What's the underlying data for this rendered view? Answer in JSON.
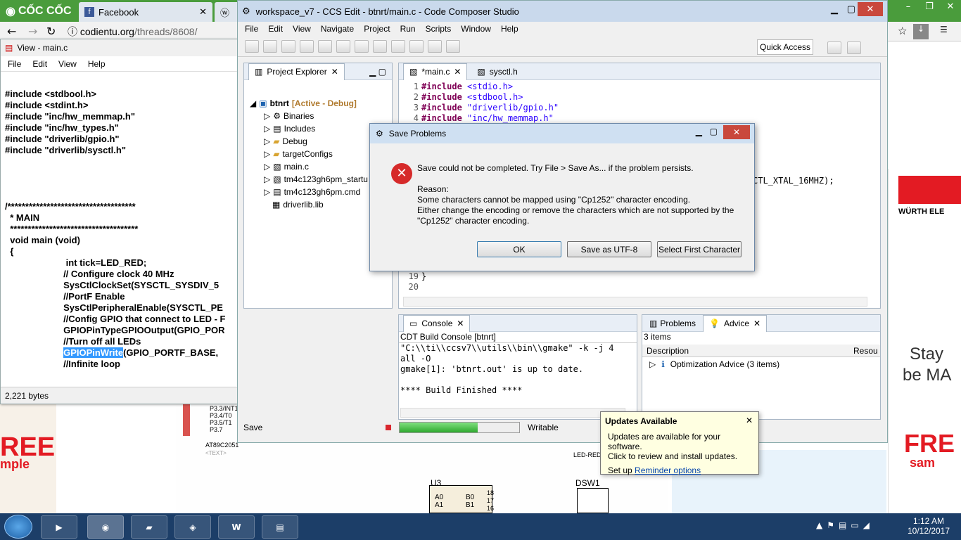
{
  "browser": {
    "brand": "CỐC CỐC",
    "tab1": "Facebook",
    "url_host": "codientu.org",
    "url_path": "/threads/8608/"
  },
  "notepad": {
    "title": "View - main.c",
    "menu": [
      "File",
      "Edit",
      "View",
      "Help"
    ],
    "lines": [
      "#include <stdbool.h>",
      "#include <stdint.h>",
      "#include \"inc/hw_memmap.h\"",
      "#include \"inc/hw_types.h\"",
      "#include \"driverlib/gpio.h\"",
      "#include \"driverlib/sysctl.h\"",
      "",
      "",
      "",
      "",
      "/************************************",
      "  * MAIN",
      "  ************************************",
      "  void main (void)",
      "  {",
      "                        int tick=LED_RED;",
      "                       // Configure clock 40 MHz",
      "                       SysCtlClockSet(SYSCTL_SYSDIV_5",
      "                       //PortF Enable",
      "                       SysCtlPeripheralEnable(SYSCTL_PE",
      "                       //Config GPIO that connect to LED - F",
      "                       GPIOPinTypeGPIOOutput(GPIO_POR",
      "                       //Turn off all LEDs"
    ],
    "sel_word": "GPIOPinWrite",
    "sel_rest": "(GPIO_PORTF_BASE,",
    "last_line": "//Infinite loop",
    "status": "2,221 bytes"
  },
  "ccs": {
    "title": "workspace_v7 - CCS Edit - btnrt/main.c - Code Composer Studio",
    "menu": [
      "File",
      "Edit",
      "View",
      "Navigate",
      "Project",
      "Run",
      "Scripts",
      "Window",
      "Help"
    ],
    "quick_access": "Quick Access",
    "explorer": {
      "tab": "Project Explorer",
      "project": "btnrt",
      "project_state": "[Active - Debug]",
      "items": [
        "Binaries",
        "Includes",
        "Debug",
        "targetConfigs",
        "main.c",
        "tm4c123gh6pm_startu",
        "tm4c123gh6pm.cmd",
        "driverlib.lib"
      ]
    },
    "editor": {
      "tab1": "*main.c",
      "tab2": "sysctl.h",
      "lines": [
        {
          "n": "1",
          "kw": "#include",
          "arg": "<stdio.h>"
        },
        {
          "n": "2",
          "kw": "#include",
          "arg": "<stdbool.h>"
        },
        {
          "n": "3",
          "kw": "#include",
          "arg": "\"driverlib/gpio.h\""
        },
        {
          "n": "4",
          "kw": "#include",
          "arg": "\"inc/hw_memmap.h\""
        }
      ],
      "partial": "CTL_XTAL_16MHZ);",
      "l19": "19",
      "l19c": "}",
      "l20": "20"
    },
    "console": {
      "tab": "Console",
      "sub": "CDT Build Console [btnrt]",
      "lines": [
        "\"C:\\\\ti\\\\ccsv7\\\\utils\\\\bin\\\\gmake\" -k -j 4",
        "all -O",
        "gmake[1]: 'btnrt.out' is up to date.",
        "",
        "**** Build Finished ****"
      ]
    },
    "problems": {
      "tab1": "Problems",
      "tab2": "Advice",
      "count": "3 items",
      "col1": "Description",
      "col2": "Resou",
      "row": "Optimization Advice (3 items)"
    },
    "status": {
      "left": "Save",
      "mode": "Writable"
    }
  },
  "dialog": {
    "title": "Save Problems",
    "message": "Save could not be completed. Try File > Save As... if the problem persists.",
    "reason_label": "Reason:",
    "reason1": "Some characters cannot be mapped using \"Cp1252\" character encoding.",
    "reason2": "Either change the encoding or remove the characters which are not supported by the",
    "reason3": "\"Cp1252\" character encoding.",
    "ok": "OK",
    "save_utf8": "Save as UTF-8",
    "select_first": "Select First Character"
  },
  "popup": {
    "title": "Updates Available",
    "line1": "Updates are available for your software.",
    "line2": "Click to review and install updates.",
    "setup": "Set up",
    "link": "Reminder options"
  },
  "schematic": {
    "pins": [
      "P3.3/INT1",
      "P3.4/T0",
      "P3.5/T1",
      "P3.7"
    ],
    "chip": "AT89C2051",
    "text": "<TEXT>",
    "u3": "U3",
    "a0": "A0",
    "a1": "A1",
    "b0": "B0",
    "b1": "B1",
    "n18": "18",
    "n17": "17",
    "n16": "16",
    "led": "LED-RED",
    "dsw": "DSW1"
  },
  "ads": {
    "left1": "REE",
    "left2": "mple",
    "right_brand": "WÜRTH ELE",
    "right_stay": "Stay",
    "right_be": "be MA",
    "right_free": "FRE",
    "right_sam": "sam"
  },
  "taskbar": {
    "time": "1:12 AM",
    "date": "10/12/2017"
  }
}
